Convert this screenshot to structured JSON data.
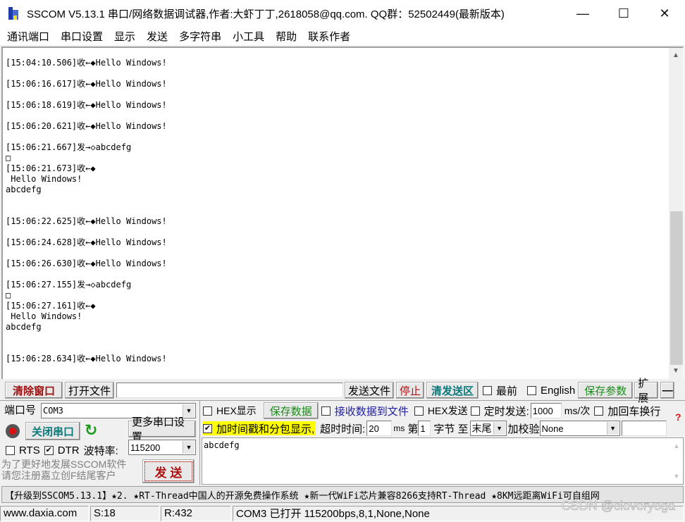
{
  "window": {
    "title": "SSCOM V5.13.1 串口/网络数据调试器,作者:大虾丁丁,2618058@qq.com. QQ群：52502449(最新版本)",
    "minimize_symbol": "—",
    "maximize_symbol": "☐",
    "close_symbol": "✕"
  },
  "menu": {
    "items": [
      "通讯端口",
      "串口设置",
      "显示",
      "发送",
      "多字符串",
      "小工具",
      "帮助",
      "联系作者"
    ]
  },
  "receive": {
    "lines": [
      "[15:04:10.506]收←◆Hello Windows!",
      "",
      "[15:06:16.617]收←◆Hello Windows!",
      "",
      "[15:06:18.619]收←◆Hello Windows!",
      "",
      "[15:06:20.621]收←◆Hello Windows!",
      "",
      "[15:06:21.667]发→◇abcdefg",
      "□",
      "[15:06:21.673]收←◆",
      " Hello Windows!",
      "abcdefg",
      "",
      "",
      "[15:06:22.625]收←◆Hello Windows!",
      "",
      "[15:06:24.628]收←◆Hello Windows!",
      "",
      "[15:06:26.630]收←◆Hello Windows!",
      "",
      "[15:06:27.155]发→◇abcdefg",
      "□",
      "[15:06:27.161]收←◆",
      " Hello Windows!",
      "abcdefg",
      "",
      "",
      "[15:06:28.634]收←◆Hello Windows!"
    ],
    "scroll_position": 0.62
  },
  "toolbar": {
    "clear_window": "清除窗口",
    "open_file": "打开文件",
    "file_path": "",
    "send_file": "发送文件",
    "stop": "停止",
    "clear_send": "清发送区",
    "topmost_label": "最前",
    "topmost_checked": false,
    "english_label": "English",
    "english_checked": false,
    "save_params": "保存参数",
    "expand": "扩展",
    "collapse": "—"
  },
  "port": {
    "port_label": "端口号",
    "port_value": "COM3",
    "close_port": "关闭串口",
    "more_settings": "更多串口设置",
    "rts_label": "RTS",
    "rts_checked": false,
    "dtr_label": "DTR",
    "dtr_checked": true,
    "baud_label": "波特率:",
    "baud_value": "115200",
    "promo_line1": "为了更好地发展SSCOM软件",
    "promo_line2": "请您注册嘉立创F结尾客户",
    "send_button": "发  送"
  },
  "options": {
    "hex_display_label": "HEX显示",
    "hex_display_checked": false,
    "save_data": "保存数据",
    "recv_to_file_label": "接收数据到文件",
    "recv_to_file_checked": false,
    "hex_send_label": "HEX发送",
    "hex_send_checked": false,
    "timed_send_label": "定时发送:",
    "timed_send_checked": false,
    "timed_interval": "1000",
    "timed_unit": "ms/次",
    "add_crlf_label": "加回车换行",
    "add_crlf_checked": false,
    "timestamp_label": "加时间戳和分包显示,",
    "timestamp_checked": true,
    "timeout_label": "超时时间:",
    "timeout_value": "20",
    "timeout_unit": "ms",
    "byte_prefix": "第",
    "byte_start": "1",
    "byte_suffix": "字节 至",
    "byte_end": "末尾",
    "checksum_label": "加校验",
    "checksum_value": "None",
    "help_symbol": "?"
  },
  "send_area": {
    "text": "abcdefg"
  },
  "marquee": {
    "text": "【升级到SSCOM5.13.1】★2. ★RT-Thread中国人的开源免费操作系统 ★新一代WiFi芯片兼容8266支持RT-Thread ★8KM远距离WiFi可自组网"
  },
  "status": {
    "website": "www.daxia.com",
    "sent": "S:18",
    "received": "R:432",
    "port_status": "COM3 已打开  115200bps,8,1,None,None"
  },
  "watermark": "CSDN @cleveryoga",
  "colors": {
    "clear_window_text": "#a01010",
    "stop_text": "#b01010",
    "clear_send_text": "#0a7a7a",
    "save_green": "#1a8a1a",
    "close_port_text": "#0a7a7a",
    "recv_to_file_text": "#2020a0",
    "timestamp_highlight": "#ffff00",
    "send_button_text": "#b01010"
  }
}
